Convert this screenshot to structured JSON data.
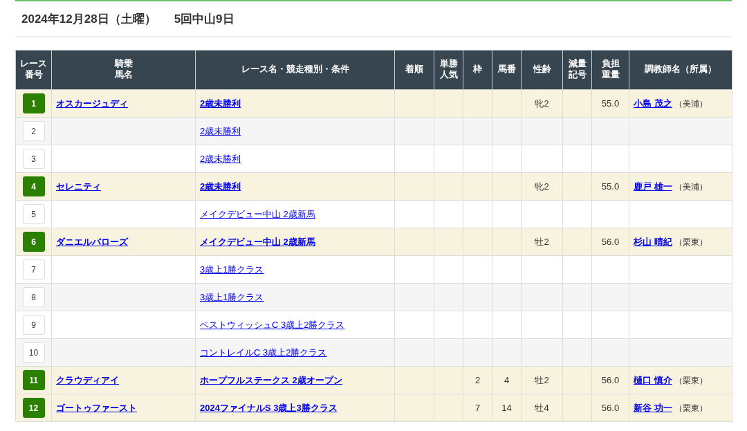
{
  "heading": {
    "date": "2024年12月28日（土曜）",
    "meeting": "5回中山9日"
  },
  "table": {
    "columns": [
      "レース番号",
      "騎乗馬名",
      "レース名・競走種別・条件",
      "着順",
      "単勝人気",
      "枠",
      "馬番",
      "性齢",
      "減量記号",
      "負担重量",
      "調教師名（所属）"
    ],
    "rows": [
      {
        "number": "1",
        "entered": true,
        "horse": "オスカージュディ",
        "race": "2歳未勝利",
        "sex_age": "牝2",
        "weight": "55.0",
        "trainer": "小島 茂之",
        "affiliation": "（美浦）"
      },
      {
        "number": "2",
        "entered": false,
        "race": "2歳未勝利"
      },
      {
        "number": "3",
        "entered": false,
        "race": "2歳未勝利"
      },
      {
        "number": "4",
        "entered": true,
        "horse": "セレニティ",
        "race": "2歳未勝利",
        "sex_age": "牝2",
        "weight": "55.0",
        "trainer": "鹿戸 雄一",
        "affiliation": "（美浦）"
      },
      {
        "number": "5",
        "entered": false,
        "race": "メイクデビュー中山 2歳新馬"
      },
      {
        "number": "6",
        "entered": true,
        "horse": "ダニエルバローズ",
        "race": "メイクデビュー中山 2歳新馬",
        "sex_age": "牡2",
        "weight": "56.0",
        "trainer": "杉山 晴紀",
        "affiliation": "（栗東）"
      },
      {
        "number": "7",
        "entered": false,
        "race": "3歳上1勝クラス"
      },
      {
        "number": "8",
        "entered": false,
        "race": "3歳上1勝クラス"
      },
      {
        "number": "9",
        "entered": false,
        "race": "ベストウィッシュC 3歳上2勝クラス"
      },
      {
        "number": "10",
        "entered": false,
        "race": "コントレイルC 3歳上2勝クラス"
      },
      {
        "number": "11",
        "entered": true,
        "horse": "クラウディアイ",
        "race": "ホープフルステークス 2歳オープン",
        "frame": "2",
        "horse_no": "4",
        "sex_age": "牡2",
        "weight": "56.0",
        "trainer": "樋口 慎介",
        "affiliation": "（栗東）"
      },
      {
        "number": "12",
        "entered": true,
        "horse": "ゴートゥファースト",
        "race": "2024ファイナルS 3歳上3勝クラス",
        "frame": "7",
        "horse_no": "14",
        "sex_age": "牡4",
        "weight": "56.0",
        "trainer": "新谷 功一",
        "affiliation": "（栗東）"
      }
    ]
  }
}
